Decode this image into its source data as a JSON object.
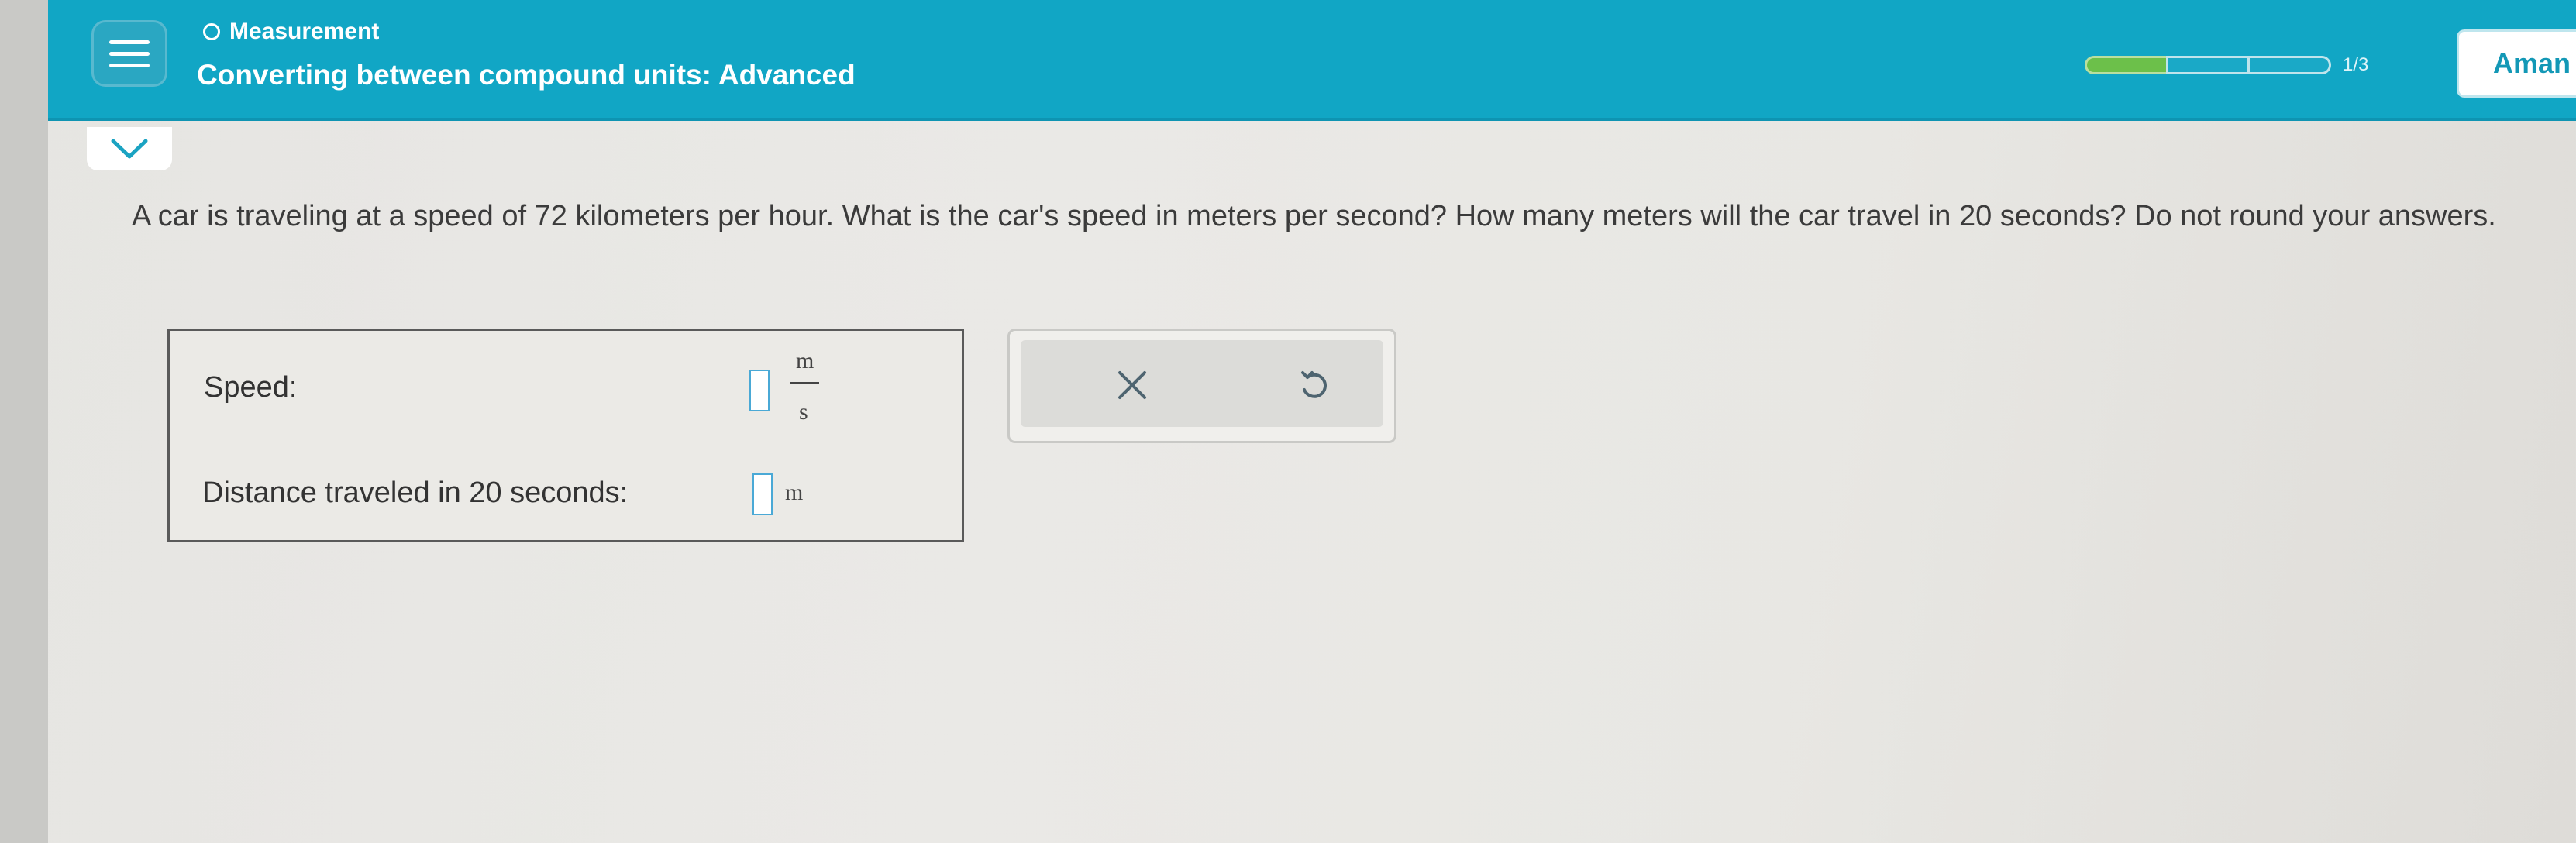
{
  "header": {
    "topic": "Measurement",
    "lesson_title": "Converting between compound units: Advanced",
    "progress_count": "1/3",
    "user_name": "Aman",
    "colors": {
      "header_bg": "#11a6c5",
      "progress_fill": "#6cc04a"
    }
  },
  "question": {
    "text": "A car is traveling at a speed of 72 kilometers per hour. What is the car's speed in meters per second? How many meters will the car travel in 20 seconds? Do not round your answers."
  },
  "answers": {
    "speed_label": "Speed:",
    "speed_value": "",
    "speed_unit_numerator": "m",
    "speed_unit_denominator": "s",
    "distance_label": "Distance traveled in 20 seconds:",
    "distance_value": "",
    "distance_unit": "m"
  },
  "actions": {
    "clear_icon": "close-icon",
    "undo_icon": "undo-icon"
  }
}
